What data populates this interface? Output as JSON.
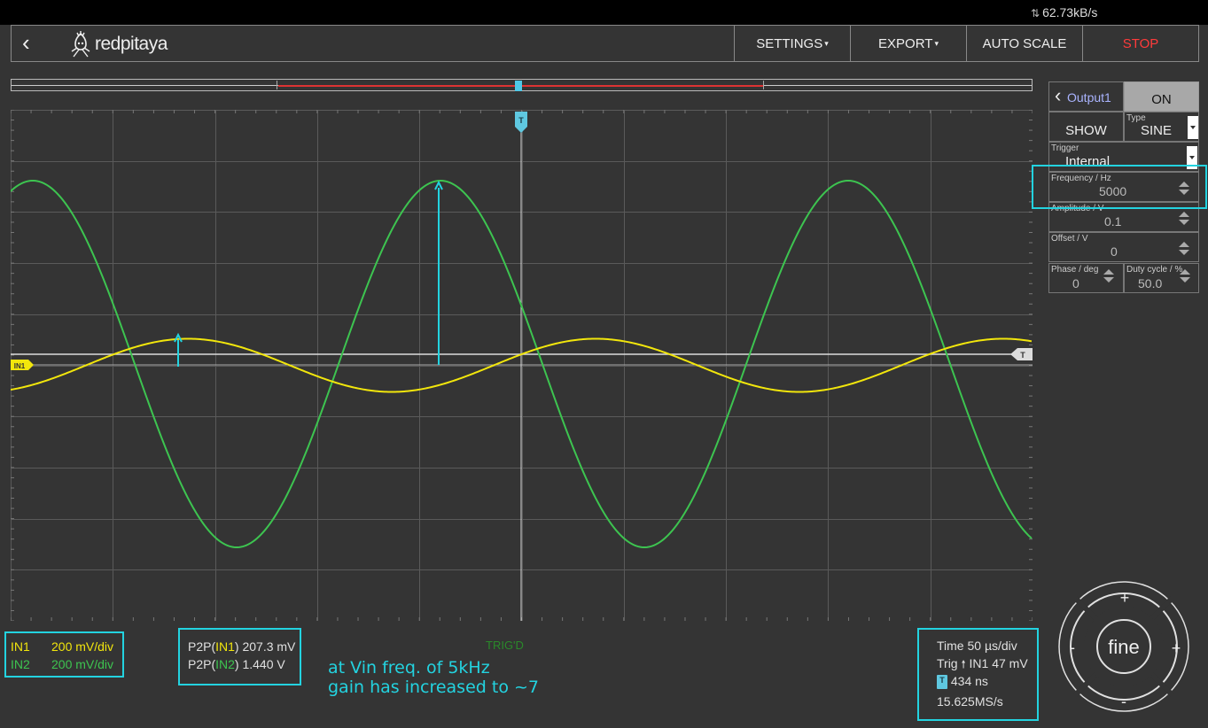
{
  "status": {
    "data_rate": "62.73kB/s"
  },
  "header": {
    "brand": "redpitaya",
    "menu": [
      "SETTINGS",
      "EXPORT",
      "AUTO SCALE",
      "STOP"
    ]
  },
  "output_panel": {
    "title": "Output1",
    "on_label": "ON",
    "show_label": "SHOW",
    "type_label": "Type",
    "type_value": "SINE",
    "trigger_label": "Trigger",
    "trigger_value": "Internal",
    "frequency_label": "Frequency / Hz",
    "frequency_value": "5000",
    "amplitude_label": "Amplitude / V",
    "amplitude_value": "0.1",
    "offset_label": "Offset / V",
    "offset_value": "0",
    "phase_label": "Phase / deg",
    "phase_value": "0",
    "duty_label": "Duty cycle / %",
    "duty_value": "50.0"
  },
  "scope": {
    "in1_marker": "IN1",
    "trigger_marker": "T",
    "trig_status": "TRIG'D",
    "colors": {
      "in1": "#f2e60c",
      "in2": "#3dc450",
      "accent": "#23d3e0"
    }
  },
  "channels": {
    "in1_label": "IN1",
    "in1_scale": "200 mV/div",
    "in2_label": "IN2",
    "in2_scale": "200 mV/div"
  },
  "measurements": {
    "p2p1_prefix": "P2P(",
    "p2p1_ch": "IN1",
    "p2p1_value": ") 207.3 mV",
    "p2p2_prefix": "P2P(",
    "p2p2_ch": "IN2",
    "p2p2_value": ") 1.440 V"
  },
  "annotation": {
    "line1": "at Vin freq. of 5kHz",
    "line2": "gain has increased to ~7"
  },
  "timebase": {
    "time": "Time 50 µs/div",
    "trig_prefix": "Trig",
    "trig_value": "IN1 47 mV",
    "delay": "434 ns",
    "sample_rate": "15.625MS/s"
  },
  "nav_pad": {
    "center": "fine",
    "plus": "+",
    "minus": "-"
  }
}
